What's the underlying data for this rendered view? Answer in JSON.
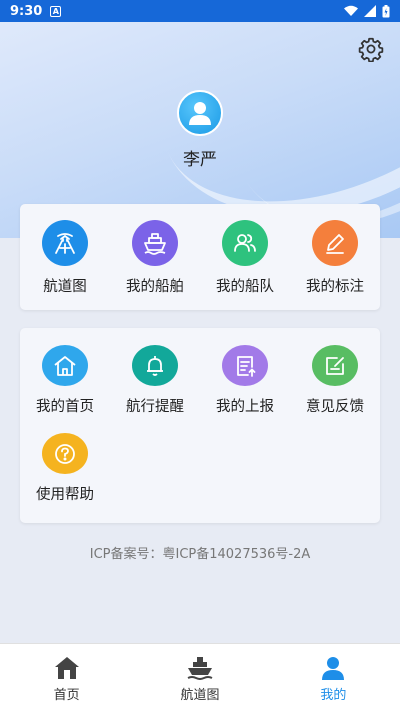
{
  "status_bar": {
    "time": "9:30",
    "notification_letter": "A"
  },
  "profile": {
    "name": "李严"
  },
  "quick_menu": [
    {
      "label": "航道图",
      "icon": "channel-map-icon",
      "color": "#1e8ee8"
    },
    {
      "label": "我的船舶",
      "icon": "ship-icon",
      "color": "#7b63e8"
    },
    {
      "label": "我的船队",
      "icon": "fleet-icon",
      "color": "#2ec27e"
    },
    {
      "label": "我的标注",
      "icon": "annotate-icon",
      "color": "#f47f3c"
    }
  ],
  "services_menu": [
    {
      "label": "我的首页",
      "icon": "home-icon",
      "color": "#2fa7ec"
    },
    {
      "label": "航行提醒",
      "icon": "bell-icon",
      "color": "#12a89a"
    },
    {
      "label": "我的上报",
      "icon": "report-icon",
      "color": "#a27ae8"
    },
    {
      "label": "意见反馈",
      "icon": "feedback-icon",
      "color": "#58bd63"
    },
    {
      "label": "使用帮助",
      "icon": "help-icon",
      "color": "#f5b31f"
    }
  ],
  "icp_text": "ICP备案号：粤ICP备14027536号-2A",
  "bottom_nav": [
    {
      "label": "首页",
      "icon": "home-icon",
      "active": false
    },
    {
      "label": "航道图",
      "icon": "ship-icon",
      "active": false
    },
    {
      "label": "我的",
      "icon": "person-icon",
      "active": true
    }
  ],
  "colors": {
    "status_bar": "#1668d8",
    "active_tab": "#1e8ee8"
  }
}
